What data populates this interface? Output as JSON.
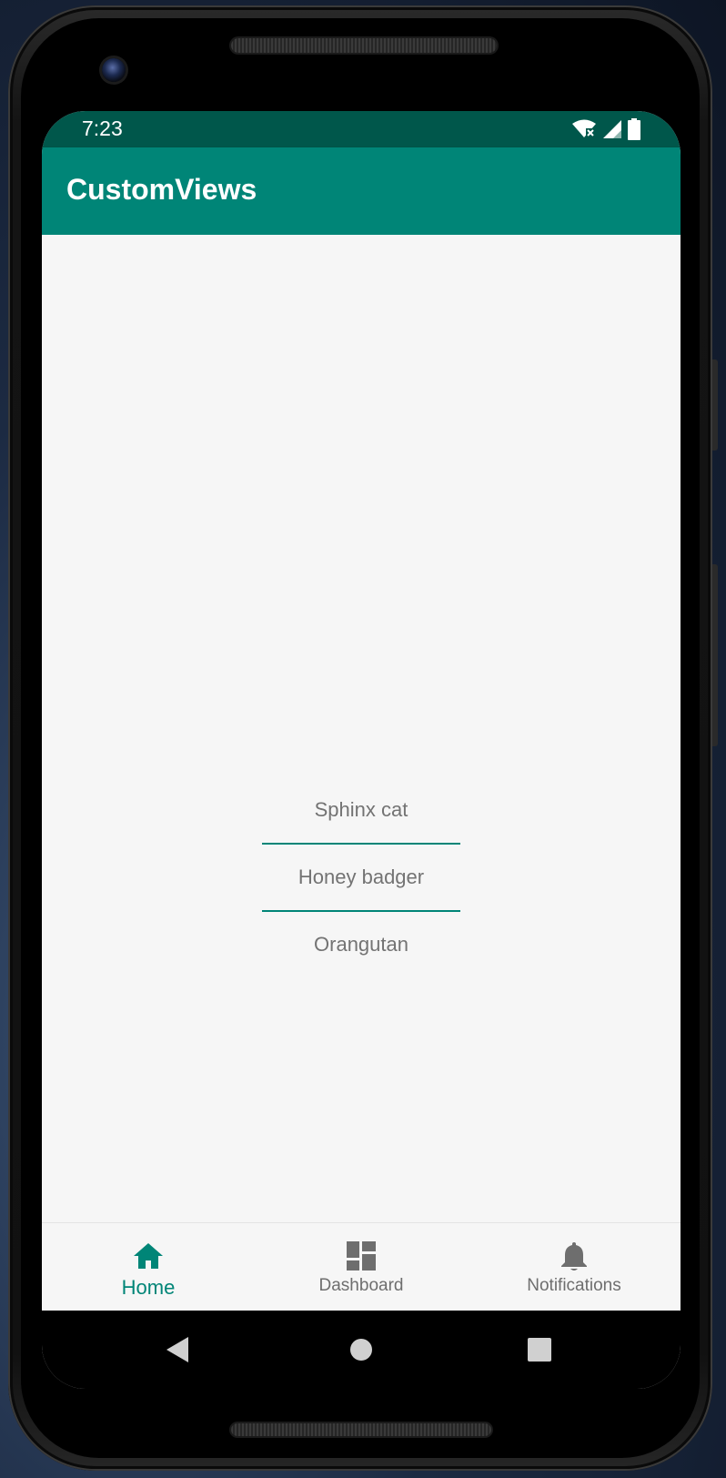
{
  "status_bar": {
    "time": "7:23",
    "icons": [
      "wifi-no-internet-icon",
      "cell-signal-icon",
      "battery-icon"
    ]
  },
  "app_bar": {
    "title": "CustomViews",
    "color": "#008577"
  },
  "picker": {
    "items": [
      "Sphinx cat",
      "Honey badger",
      "Orangutan"
    ],
    "divider_color": "#008577"
  },
  "bottom_nav": {
    "items": [
      {
        "label": "Home",
        "icon": "home-icon",
        "active": true
      },
      {
        "label": "Dashboard",
        "icon": "dashboard-icon",
        "active": false
      },
      {
        "label": "Notifications",
        "icon": "bell-icon",
        "active": false
      }
    ],
    "active_color": "#008577",
    "inactive_color": "#6e6e6e"
  },
  "system_nav": {
    "buttons": [
      "back-icon",
      "home-circle-icon",
      "recents-icon"
    ]
  },
  "colors": {
    "status_bar": "#00574b",
    "primary": "#008577",
    "background": "#f6f6f6"
  }
}
